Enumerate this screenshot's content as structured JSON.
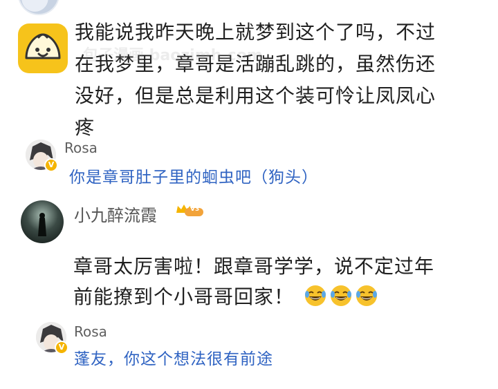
{
  "comment1": {
    "lines": [
      "我能说我昨天晚上就梦到这个了吗，不过",
      "在我梦里，章哥是活蹦乱跳的，虽然伤还",
      "没好，但是总是利用这个装可怜让凤凤心",
      "疼"
    ],
    "reply": {
      "name": "Rosa",
      "text": "你是章哥肚子里的蛔虫吧（狗头）"
    }
  },
  "comment2": {
    "user": "小九醉流霞",
    "level_badge": "V3",
    "lines": [
      "章哥太厉害啦！跟章哥学学，说不定过年",
      "前能撩到个小哥哥回家！"
    ],
    "emoji_names": [
      "laughing-crying-emoji",
      "laughing-crying-emoji",
      "laughing-crying-emoji"
    ],
    "reply": {
      "name": "Rosa",
      "text": "蓬友，你这个想法很有前途"
    }
  },
  "verified_badge": "V",
  "watermark": "包子漫画 baozimh.com",
  "colors": {
    "reply_link": "#2f63c2",
    "bun_avatar": "#f6c31b",
    "badge": "#f5b400"
  }
}
